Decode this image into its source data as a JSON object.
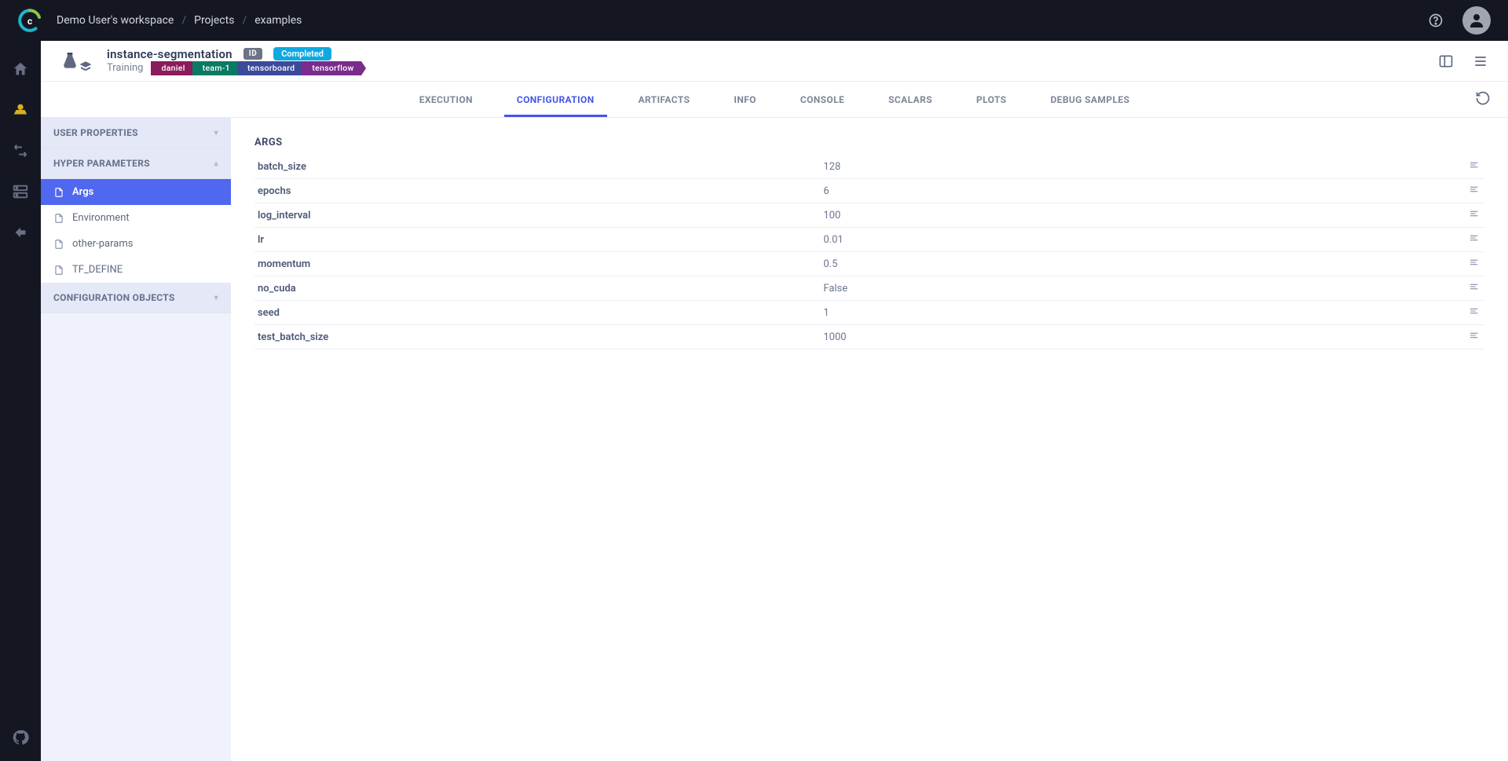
{
  "breadcrumbs": {
    "workspace": "Demo User's workspace",
    "projects": "Projects",
    "project_name": "examples"
  },
  "project": {
    "name": "instance-segmentation",
    "id_badge": "ID",
    "status": "Completed",
    "subtitle": "Training",
    "tags": {
      "daniel": "daniel",
      "team1": "team-1",
      "tensorboard": "tensorboard",
      "tensorflow": "tensorflow"
    }
  },
  "tabs": {
    "execution": "EXECUTION",
    "configuration": "CONFIGURATION",
    "artifacts": "ARTIFACTS",
    "info": "INFO",
    "console": "CONSOLE",
    "scalars": "SCALARS",
    "plots": "PLOTS",
    "debug_samples": "DEBUG SAMPLES"
  },
  "sidebar": {
    "user_properties": "USER PROPERTIES",
    "hyper_parameters": "HYPER PARAMETERS",
    "items": {
      "args": "Args",
      "environment": "Environment",
      "other_params": "other-params",
      "tf_define": "TF_DEFINE"
    },
    "config_objects": "CONFIGURATION OBJECTS"
  },
  "detail": {
    "heading": "ARGS",
    "params": [
      {
        "name": "batch_size",
        "value": "128"
      },
      {
        "name": "epochs",
        "value": "6"
      },
      {
        "name": "log_interval",
        "value": "100"
      },
      {
        "name": "lr",
        "value": "0.01"
      },
      {
        "name": "momentum",
        "value": "0.5"
      },
      {
        "name": "no_cuda",
        "value": "False"
      },
      {
        "name": "seed",
        "value": "1"
      },
      {
        "name": "test_batch_size",
        "value": "1000"
      }
    ]
  }
}
